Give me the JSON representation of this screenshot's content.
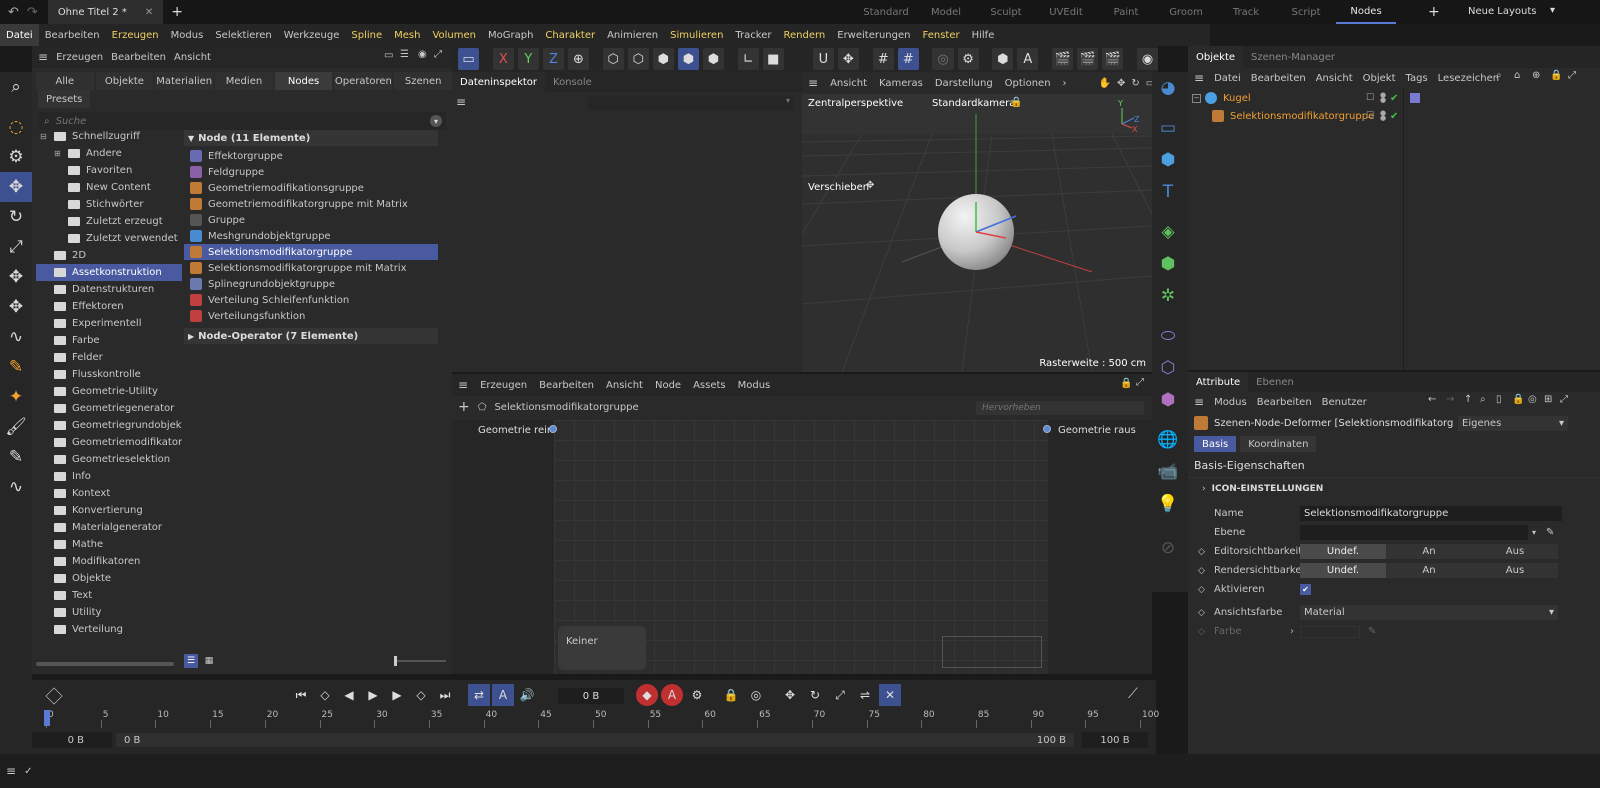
{
  "titlebar": {
    "doc_tab": "Ohne Titel 2 *",
    "workspace_tabs": [
      "Standard",
      "Model",
      "Sculpt",
      "UVEdit",
      "Paint",
      "Groom",
      "Track",
      "Script",
      "Nodes"
    ],
    "active_workspace": "Nodes",
    "layouts_label": "Neue Layouts"
  },
  "menubar": {
    "items": [
      "Datei",
      "Bearbeiten",
      "Erzeugen",
      "Modus",
      "Selektieren",
      "Werkzeuge",
      "Spline",
      "Mesh",
      "Volumen",
      "MoGraph",
      "Charakter",
      "Animieren",
      "Simulieren",
      "Tracker",
      "Rendern",
      "Erweiterungen",
      "Fenster",
      "Hilfe"
    ]
  },
  "asset_browser": {
    "menu": [
      "Erzeugen",
      "Bearbeiten",
      "Ansicht"
    ],
    "tabs": [
      "Alle",
      "Objekte",
      "Materialien",
      "Medien",
      "Nodes",
      "Operatoren",
      "Szenen"
    ],
    "active_tab": "Nodes",
    "presets_label": "Presets",
    "search_placeholder": "Suche",
    "tree": [
      {
        "label": "Schnellzugriff",
        "indent": 0
      },
      {
        "label": "Andere",
        "indent": 1
      },
      {
        "label": "Favoriten",
        "indent": 1
      },
      {
        "label": "New Content",
        "indent": 1
      },
      {
        "label": "Stichwörter",
        "indent": 1
      },
      {
        "label": "Zuletzt erzeugt",
        "indent": 1
      },
      {
        "label": "Zuletzt verwendet",
        "indent": 1
      },
      {
        "label": "2D",
        "indent": 0
      },
      {
        "label": "Assetkonstruktion",
        "indent": 0
      },
      {
        "label": "Datenstrukturen",
        "indent": 0
      },
      {
        "label": "Effektoren",
        "indent": 0
      },
      {
        "label": "Experimentell",
        "indent": 0
      },
      {
        "label": "Farbe",
        "indent": 0
      },
      {
        "label": "Felder",
        "indent": 0
      },
      {
        "label": "Flusskontrolle",
        "indent": 0
      },
      {
        "label": "Geometrie-Utility",
        "indent": 0
      },
      {
        "label": "Geometriegenerator",
        "indent": 0
      },
      {
        "label": "Geometriegrundobjekte",
        "indent": 0
      },
      {
        "label": "Geometriemodifikator",
        "indent": 0
      },
      {
        "label": "Geometrieselektion",
        "indent": 0
      },
      {
        "label": "Info",
        "indent": 0
      },
      {
        "label": "Kontext",
        "indent": 0
      },
      {
        "label": "Konvertierung",
        "indent": 0
      },
      {
        "label": "Materialgenerator",
        "indent": 0
      },
      {
        "label": "Mathe",
        "indent": 0
      },
      {
        "label": "Modifikatoren",
        "indent": 0
      },
      {
        "label": "Objekte",
        "indent": 0
      },
      {
        "label": "Text",
        "indent": 0
      },
      {
        "label": "Utility",
        "indent": 0
      },
      {
        "label": "Verteilung",
        "indent": 0
      }
    ],
    "selected_tree_item": "Assetkonstruktion",
    "group1_header": "Node (11 Elemente)",
    "nodes": [
      {
        "label": "Effektorgruppe",
        "color": "#6a6ab0"
      },
      {
        "label": "Feldgruppe",
        "color": "#8a60a8"
      },
      {
        "label": "Geometriemodifikationsgruppe",
        "color": "#c07a38"
      },
      {
        "label": "Geometriemodifikatorgruppe mit Matrix",
        "color": "#c07a38"
      },
      {
        "label": "Gruppe",
        "color": "#555555"
      },
      {
        "label": "Meshgrundobjektgruppe",
        "color": "#4a8ad0"
      },
      {
        "label": "Selektionsmodifikatorgruppe",
        "color": "#c07a38"
      },
      {
        "label": "Selektionsmodifikatorgruppe mit Matrix",
        "color": "#c07a38"
      },
      {
        "label": "Splinegrundobjektgruppe",
        "color": "#6a7ab0"
      },
      {
        "label": "Verteilung Schleifenfunktion",
        "color": "#c04040"
      },
      {
        "label": "Verteilungsfunktion",
        "color": "#c04040"
      }
    ],
    "selected_node": "Selektionsmodifikatorgruppe",
    "group2_header": "Node-Operator (7 Elemente)"
  },
  "data_inspector": {
    "tabs": [
      "Dateninspektor",
      "Konsole"
    ]
  },
  "viewport": {
    "menu": [
      "Ansicht",
      "Kameras",
      "Darstellung",
      "Optionen"
    ],
    "perspective": "Zentralperspektive",
    "camera": "Standardkamera",
    "tool_label": "Verschieben",
    "grid_label": "Rasterweite : 500 cm"
  },
  "node_editor": {
    "menu": [
      "Erzeugen",
      "Bearbeiten",
      "Ansicht",
      "Node",
      "Assets",
      "Modus"
    ],
    "breadcrumb": "Selektionsmodifikatorgruppe",
    "search_placeholder": "Hervorheben",
    "input_port": "Geometrie rein",
    "output_port": "Geometrie raus",
    "empty_node": "Keiner"
  },
  "objects_panel": {
    "tabs": [
      "Objekte",
      "Szenen-Manager"
    ],
    "menu": [
      "Datei",
      "Bearbeiten",
      "Ansicht",
      "Objekt",
      "Tags",
      "Lesezeichen"
    ],
    "objects": [
      {
        "label": "Kugel",
        "indent": 0
      },
      {
        "label": "Selektionsmodifikatorgruppe",
        "indent": 1
      }
    ]
  },
  "attributes_panel": {
    "tabs": [
      "Attribute",
      "Ebenen"
    ],
    "menu": [
      "Modus",
      "Bearbeiten",
      "Benutzer"
    ],
    "object_title": "Szenen-Node-Deformer [Selektionsmodifikatorgrupp",
    "mode_dropdown": "Eigenes",
    "subtabs": [
      "Basis",
      "Koordinaten"
    ],
    "section_title": "Basis-Eigenschaften",
    "subsection": "ICON-EINSTELLUNGEN",
    "name_label": "Name",
    "name_value": "Selektionsmodifikatorgruppe",
    "layer_label": "Ebene",
    "editor_vis_label": "Editorsichtbarkeit",
    "render_vis_label": "Rendersichtbarkeit",
    "vis_options": [
      "Undef.",
      "An",
      "Aus"
    ],
    "activate_label": "Aktivieren",
    "display_color_label": "Ansichtsfarbe",
    "display_color_value": "Material",
    "color_label": "Farbe"
  },
  "timeline": {
    "frame_field": "0 B",
    "ticks": [
      "0",
      "5",
      "10",
      "15",
      "20",
      "25",
      "30",
      "35",
      "40",
      "45",
      "50",
      "55",
      "60",
      "65",
      "70",
      "75",
      "80",
      "85",
      "90",
      "95",
      "100"
    ],
    "start_left": "0 B",
    "start_right": "0 B",
    "end_left": "100 B",
    "end_right": "100 B"
  },
  "colors": {
    "accent": "#4a5aa0",
    "yellow_menu": "#f0d060",
    "object_orange": "#f0a030",
    "check_green": "#40c040"
  }
}
